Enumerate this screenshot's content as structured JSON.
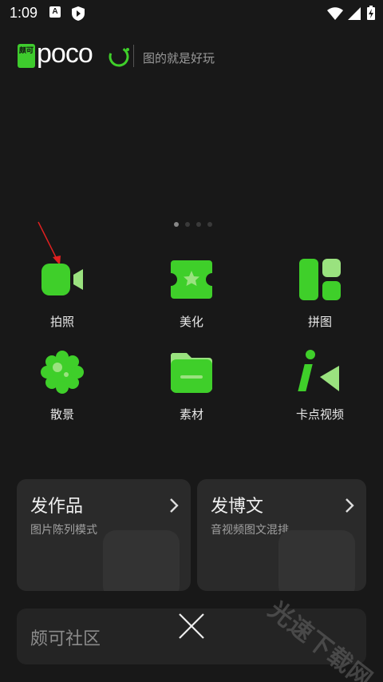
{
  "status_bar": {
    "time": "1:09",
    "a_icon_letter": "A"
  },
  "header": {
    "logo_badge": "颇可",
    "logo_text": "poco",
    "slogan": "图的就是好玩"
  },
  "pager": {
    "page_count": 4,
    "active_index": 0
  },
  "features": [
    {
      "label": "拍照",
      "icon": "video-camera-icon"
    },
    {
      "label": "美化",
      "icon": "ticket-star-icon"
    },
    {
      "label": "拼图",
      "icon": "collage-grid-icon"
    },
    {
      "label": "散景",
      "icon": "bokeh-flower-icon"
    },
    {
      "label": "素材",
      "icon": "folder-icon"
    },
    {
      "label": "卡点视频",
      "icon": "beat-video-icon"
    }
  ],
  "cards": [
    {
      "title": "发作品",
      "subtitle": "图片陈列模式"
    },
    {
      "title": "发博文",
      "subtitle": "音视频图文混排"
    }
  ],
  "community": {
    "title": "颇可社区"
  },
  "watermark": "光速下载网",
  "colors": {
    "accent": "#3fcf2a",
    "background": "#181818",
    "card": "#2a2a2a",
    "annotation_arrow": "#e02020"
  }
}
